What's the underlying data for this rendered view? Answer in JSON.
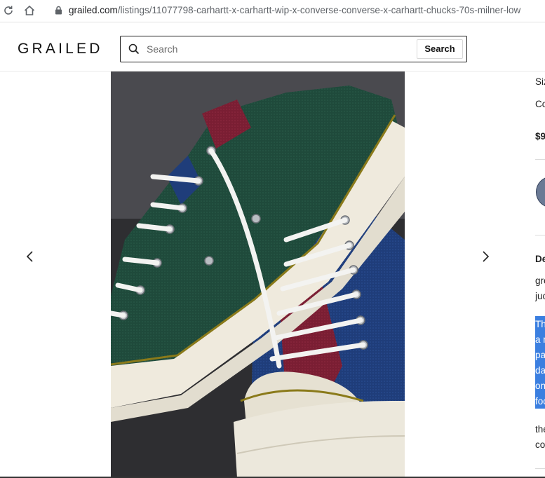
{
  "browser": {
    "url_domain": "grailed.com",
    "url_path": "/listings/11077798-carhartt-x-carhartt-wip-x-converse-converse-x-carhartt-chucks-70s-milner-low"
  },
  "header": {
    "logo": "GRAILED",
    "search_placeholder": "Search",
    "search_button": "Search"
  },
  "details": {
    "size_label": "Siz",
    "condition_label": "Co",
    "price": "$9",
    "description_heading": "De",
    "desc_lines": [
      "gre",
      "juc"
    ],
    "highlighted_lines": [
      "Th",
      "a r",
      "pa",
      "da",
      "on",
      "foo"
    ],
    "more_lines": [
      "the",
      "co"
    ]
  },
  "colors": {
    "selection": "#3b7fe0",
    "text": "#222222"
  }
}
